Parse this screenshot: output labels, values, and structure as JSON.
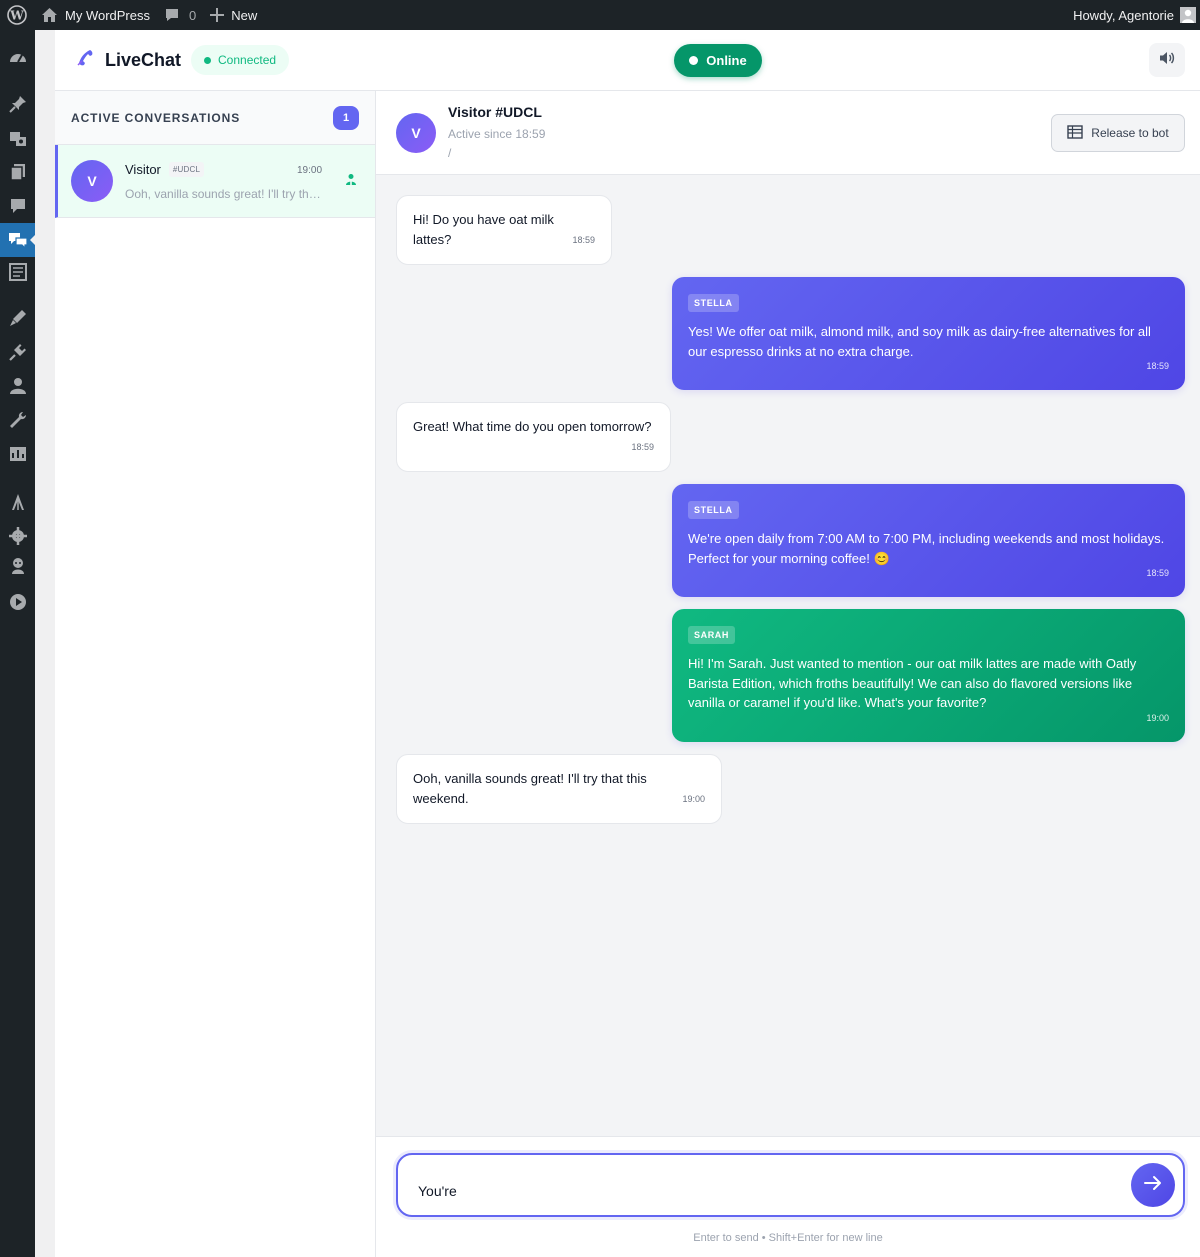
{
  "admin_bar": {
    "site_name": "My WordPress",
    "comments_count": "0",
    "new_label": "New",
    "greeting": "Howdy, Agentorie"
  },
  "admin_menu": {
    "icons": [
      "dashboard-icon",
      "pin-icon",
      "media-icon",
      "pages-icon",
      "comments-icon",
      "livechat-icon",
      "forms-icon",
      "appearance-icon",
      "plugins-icon",
      "users-icon",
      "tools-icon",
      "settings-icon",
      "plugin-a-icon",
      "plugin-b-icon",
      "plugin-c-icon",
      "play-icon"
    ]
  },
  "header": {
    "app_name": "LiveChat",
    "connection_status": "Connected",
    "online_label": "Online"
  },
  "conversations": {
    "title": "ACTIVE CONVERSATIONS",
    "count": "1",
    "items": [
      {
        "avatar_letter": "V",
        "name": "Visitor",
        "tag": "#UDCL",
        "time": "19:00",
        "preview": "Ooh, vanilla sounds great! I'll try that this weekend."
      }
    ]
  },
  "chat": {
    "avatar_letter": "V",
    "title": "Visitor #UDCL",
    "subtitle": "Active since 18:59",
    "path": "/",
    "release_label": "Release to bot",
    "messages": [
      {
        "sender": "visitor",
        "text": "Hi! Do you have oat milk lattes?",
        "time": "18:59"
      },
      {
        "sender": "STELLA",
        "text": "Yes! We offer oat milk, almond milk, and soy milk as dairy-free alternatives for all our espresso drinks at no extra charge.",
        "time": "18:59"
      },
      {
        "sender": "visitor",
        "text": "Great! What time do you open tomorrow?",
        "time": "18:59"
      },
      {
        "sender": "STELLA",
        "text": "We're open daily from 7:00 AM to 7:00 PM, including weekends and most holidays. Perfect for your morning coffee! 😊",
        "time": "18:59"
      },
      {
        "sender": "SARAH",
        "text": "Hi! I'm Sarah. Just wanted to mention - our oat milk lattes are made with Oatly Barista Edition, which froths beautifully! We can also do flavored versions like vanilla or caramel if you'd like. What's your favorite?",
        "time": "19:00"
      },
      {
        "sender": "visitor",
        "text": "Ooh, vanilla sounds great! I'll try that this weekend.",
        "time": "19:00"
      }
    ]
  },
  "composer": {
    "value": "You're",
    "hint": "Enter to send • Shift+Enter for new line"
  },
  "colors": {
    "accent": "#6366f1",
    "agent_stella": "#4f46e5",
    "agent_sarah": "#059669",
    "online": "#059669",
    "wp_dark": "#1d2327",
    "wp_active": "#2271b1"
  }
}
